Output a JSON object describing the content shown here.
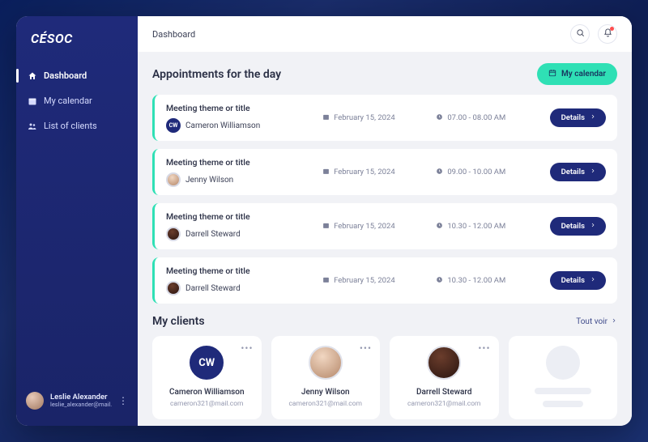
{
  "brand": "CÉSOC",
  "nav": [
    {
      "label": "Dashboard",
      "icon": "home",
      "active": true
    },
    {
      "label": "My calendar",
      "icon": "calendar",
      "active": false
    },
    {
      "label": "List of clients",
      "icon": "people",
      "active": false
    }
  ],
  "profile": {
    "name": "Leslie Alexander",
    "email": "leslie_alexander@mail.com"
  },
  "topbar": {
    "breadcrumb": "Dashboard"
  },
  "section": {
    "appointments_title": "Appointments for the day",
    "calendar_button": "My calendar",
    "clients_title": "My clients",
    "view_all": "Tout voir",
    "details_label": "Details"
  },
  "appointments": [
    {
      "title": "Meeting theme or title",
      "person": "Cameron Williamson",
      "date": "February 15, 2024",
      "time": "07.00 - 08.00 AM",
      "avatar": "initials",
      "initials": "CW"
    },
    {
      "title": "Meeting theme or title",
      "person": "Jenny Wilson",
      "date": "February 15, 2024",
      "time": "09.00 - 10.00 AM",
      "avatar": "photo1"
    },
    {
      "title": "Meeting theme or title",
      "person": "Darrell Steward",
      "date": "February 15, 2024",
      "time": "10.30 - 12.00 AM",
      "avatar": "photo2"
    },
    {
      "title": "Meeting theme or title",
      "person": "Darrell Steward",
      "date": "February 15, 2024",
      "time": "10.30 - 12.00 AM",
      "avatar": "photo2"
    }
  ],
  "clients": [
    {
      "name": "Cameron Williamson",
      "email": "cameron321@mail.com",
      "avatar": "cw",
      "initials": "CW"
    },
    {
      "name": "Jenny Wilson",
      "email": "cameron321@mail.com",
      "avatar": "p1"
    },
    {
      "name": "Darrell Steward",
      "email": "cameron321@mail.com",
      "avatar": "p2"
    },
    {
      "placeholder": true
    }
  ]
}
